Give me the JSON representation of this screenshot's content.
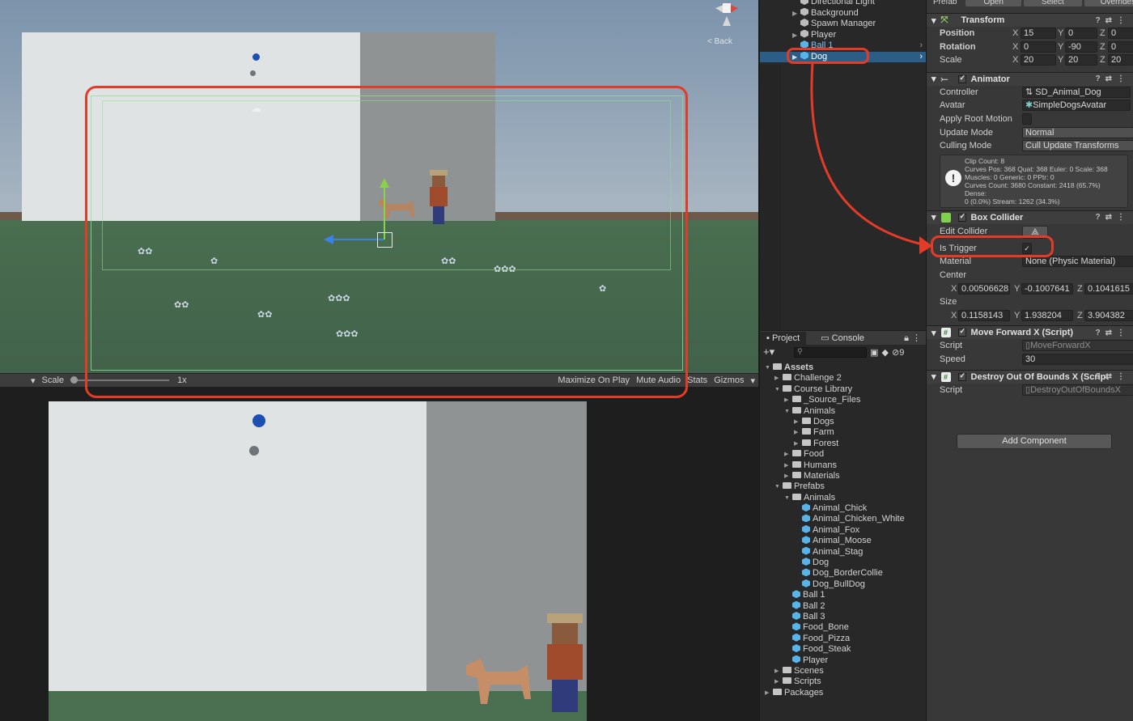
{
  "scene": {
    "back_label": "Back",
    "toolbar": {
      "scale_label": "Scale",
      "scale_value": "1x",
      "maximize_label": "Maximize On Play",
      "mute_label": "Mute Audio",
      "stats_label": "Stats",
      "gizmos_label": "Gizmos"
    }
  },
  "hierarchy": {
    "items": [
      {
        "label": "Directional Light",
        "icon": "gameobject-icon"
      },
      {
        "label": "Background",
        "icon": "gameobject-icon"
      },
      {
        "label": "Spawn Manager",
        "icon": "gameobject-icon"
      },
      {
        "label": "Player",
        "icon": "gameobject-icon"
      },
      {
        "label": "Ball 1",
        "icon": "prefab-icon"
      },
      {
        "label": "Dog",
        "icon": "prefab-icon"
      }
    ],
    "selected": "Dog"
  },
  "project": {
    "tabs": [
      "Project",
      "Console"
    ],
    "hidden_count": "9",
    "tree": [
      {
        "label": "Assets",
        "depth": 0,
        "type": "folder",
        "open": true,
        "bold": true
      },
      {
        "label": "Challenge 2",
        "depth": 1,
        "type": "folder",
        "open": false
      },
      {
        "label": "Course Library",
        "depth": 1,
        "type": "folder",
        "open": true
      },
      {
        "label": "_Source_Files",
        "depth": 2,
        "type": "folder",
        "open": false
      },
      {
        "label": "Animals",
        "depth": 2,
        "type": "folder",
        "open": true
      },
      {
        "label": "Dogs",
        "depth": 3,
        "type": "folder",
        "open": false
      },
      {
        "label": "Farm",
        "depth": 3,
        "type": "folder",
        "open": false
      },
      {
        "label": "Forest",
        "depth": 3,
        "type": "folder",
        "open": false
      },
      {
        "label": "Food",
        "depth": 2,
        "type": "folder",
        "open": false
      },
      {
        "label": "Humans",
        "depth": 2,
        "type": "folder",
        "open": false
      },
      {
        "label": "Materials",
        "depth": 2,
        "type": "folder",
        "open": false
      },
      {
        "label": "Prefabs",
        "depth": 1,
        "type": "folder",
        "open": true
      },
      {
        "label": "Animals",
        "depth": 2,
        "type": "folder",
        "open": true
      },
      {
        "label": "Animal_Chick",
        "depth": 3,
        "type": "prefab"
      },
      {
        "label": "Animal_Chicken_White",
        "depth": 3,
        "type": "prefab"
      },
      {
        "label": "Animal_Fox",
        "depth": 3,
        "type": "prefab"
      },
      {
        "label": "Animal_Moose",
        "depth": 3,
        "type": "prefab"
      },
      {
        "label": "Animal_Stag",
        "depth": 3,
        "type": "prefab"
      },
      {
        "label": "Dog",
        "depth": 3,
        "type": "prefab"
      },
      {
        "label": "Dog_BorderCollie",
        "depth": 3,
        "type": "prefab"
      },
      {
        "label": "Dog_BullDog",
        "depth": 3,
        "type": "prefab"
      },
      {
        "label": "Ball 1",
        "depth": 2,
        "type": "prefab"
      },
      {
        "label": "Ball 2",
        "depth": 2,
        "type": "prefab"
      },
      {
        "label": "Ball 3",
        "depth": 2,
        "type": "prefab"
      },
      {
        "label": "Food_Bone",
        "depth": 2,
        "type": "prefab"
      },
      {
        "label": "Food_Pizza",
        "depth": 2,
        "type": "prefab"
      },
      {
        "label": "Food_Steak",
        "depth": 2,
        "type": "prefab"
      },
      {
        "label": "Player",
        "depth": 2,
        "type": "prefab"
      },
      {
        "label": "Scenes",
        "depth": 1,
        "type": "folder",
        "open": false
      },
      {
        "label": "Scripts",
        "depth": 1,
        "type": "folder",
        "open": false
      },
      {
        "label": "Packages",
        "depth": 0,
        "type": "folder",
        "open": false
      }
    ]
  },
  "inspector": {
    "prefab": {
      "label": "Prefab",
      "open": "Open",
      "select": "Select",
      "overrides": "Overrides"
    },
    "transform": {
      "title": "Transform",
      "position": {
        "label": "Position",
        "x": "15",
        "y": "0",
        "z": "0"
      },
      "rotation": {
        "label": "Rotation",
        "x": "0",
        "y": "-90",
        "z": "0"
      },
      "scale": {
        "label": "Scale",
        "x": "20",
        "y": "20",
        "z": "20"
      }
    },
    "animator": {
      "title": "Animator",
      "controller_label": "Controller",
      "controller_value": "SD_Animal_Dog",
      "avatar_label": "Avatar",
      "avatar_value": "SimpleDogsAvatar",
      "root_motion_label": "Apply Root Motion",
      "update_mode_label": "Update Mode",
      "update_mode_value": "Normal",
      "culling_mode_label": "Culling Mode",
      "culling_mode_value": "Cull Update Transforms",
      "info": [
        "Clip Count: 8",
        "Curves Pos: 368 Quat: 368 Euler: 0 Scale: 368",
        "Muscles: 0 Generic: 0 PPtr: 0",
        "Curves Count: 3680 Constant: 2418 (65.7%) Dense:",
        "0 (0.0%) Stream: 1262 (34.3%)"
      ]
    },
    "box_collider": {
      "title": "Box Collider",
      "edit_label": "Edit Collider",
      "trigger_label": "Is Trigger",
      "material_label": "Material",
      "material_value": "None (Physic Material)",
      "center_label": "Center",
      "center": {
        "x": "0.00506628",
        "y": "-0.1007641",
        "z": "0.1041615"
      },
      "size_label": "Size",
      "size": {
        "x": "0.1158143",
        "y": "1.938204",
        "z": "3.904382"
      }
    },
    "move_forward": {
      "title": "Move Forward X (Script)",
      "script_label": "Script",
      "script_value": "MoveForwardX",
      "speed_label": "Speed",
      "speed_value": "30"
    },
    "destroy": {
      "title": "Destroy Out Of Bounds X (Script",
      "script_label": "Script",
      "script_value": "DestroyOutOfBoundsX"
    },
    "add_component": "Add Component"
  },
  "colors": {
    "highlight": "#e23c28",
    "selection": "#2c5d87",
    "collider": "#8fe08f",
    "prefab_blue": "#58b3e8"
  }
}
